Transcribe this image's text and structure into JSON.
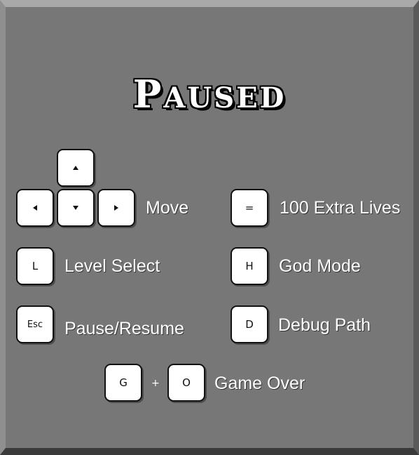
{
  "title": "Paused",
  "keys": {
    "up": "up-arrow",
    "left": "left-arrow",
    "down": "down-arrow",
    "right": "right-arrow",
    "equals": "=",
    "l": "L",
    "h": "H",
    "esc": "Esc",
    "d": "D",
    "g": "G",
    "o": "O"
  },
  "labels": {
    "move": "Move",
    "extra_lives": "100 Extra Lives",
    "level_select": "Level Select",
    "god_mode": "God Mode",
    "pause_resume": "Pause/Resume",
    "debug_path": "Debug Path",
    "plus": "+",
    "game_over": "Game Over"
  },
  "colors": {
    "panel": "#777777",
    "key_face": "#ffffff",
    "text": "#ffffff"
  }
}
